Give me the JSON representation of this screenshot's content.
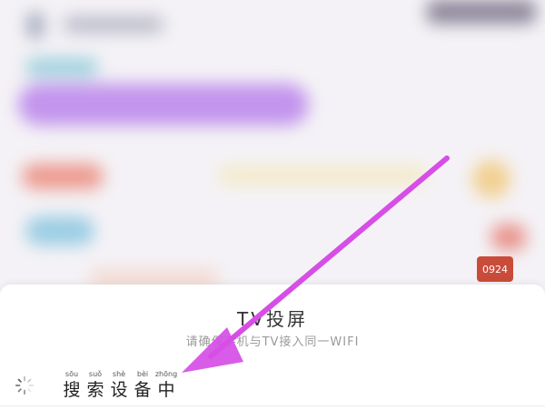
{
  "background": {
    "badge_text": "0924"
  },
  "sheet": {
    "title": "TV投屏",
    "hint": "请确保手机与TV接入同一WIFI",
    "searching": {
      "chars": [
        {
          "pinyin": "sōu",
          "hanzi": "搜"
        },
        {
          "pinyin": "suǒ",
          "hanzi": "索"
        },
        {
          "pinyin": "shè",
          "hanzi": "设"
        },
        {
          "pinyin": "bèi",
          "hanzi": "备"
        },
        {
          "pinyin": "zhōng",
          "hanzi": "中"
        }
      ]
    }
  },
  "colors": {
    "arrow": "#d64ee6",
    "sheet_bg": "#ffffff"
  },
  "icons": {
    "loading": "loading-spinner-icon"
  }
}
